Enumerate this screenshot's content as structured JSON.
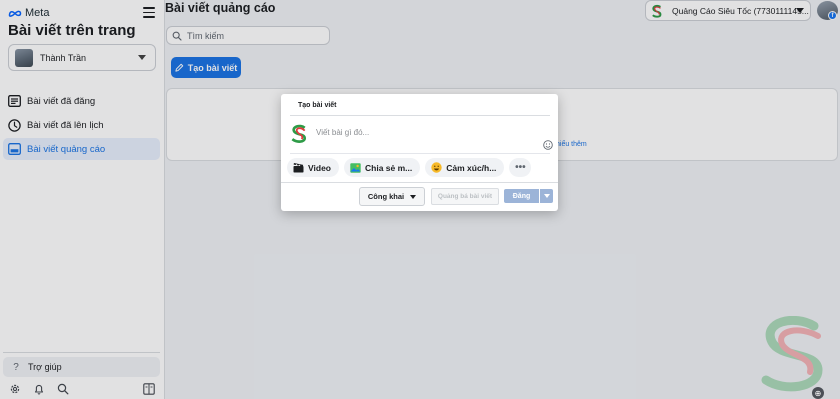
{
  "brand": {
    "name": "Meta",
    "icon": "meta-infinity-icon"
  },
  "sidebar": {
    "page_title": "Bài viết trên trang",
    "account": {
      "name": "Thành Trần"
    },
    "items": [
      {
        "label": "Bài viết đã đăng",
        "icon": "published-posts-icon",
        "active": false
      },
      {
        "label": "Bài viết đã lên lịch",
        "icon": "clock-icon",
        "active": false
      },
      {
        "label": "Bài viết quảng cáo",
        "icon": "ad-posts-icon",
        "active": true
      }
    ],
    "help": {
      "label": "Trợ giúp",
      "icon": "question-icon"
    },
    "footer_icons": [
      "settings-icon",
      "bell-icon",
      "search-icon",
      "panel-toggle-icon"
    ]
  },
  "header": {
    "title": "Bài viết quảng cáo",
    "business": {
      "name": "Quảng Cáo Siêu Tốc (7730111145..."
    }
  },
  "search": {
    "placeholder": "Tìm kiếm"
  },
  "toolbar": {
    "create_label": "Tạo bài viết"
  },
  "content": {
    "learn_more": "hiểu thêm"
  },
  "modal": {
    "title": "Tạo bài viết",
    "composer_placeholder": "Viết bài gì đó...",
    "attachments": [
      {
        "label": "Video",
        "icon": "video-camera-icon"
      },
      {
        "label": "Chia sẻ m...",
        "icon": "photo-icon"
      },
      {
        "label": "Cảm xúc/h...",
        "icon": "smiley-icon"
      }
    ],
    "more_label": "•••",
    "privacy_label": "Công khai",
    "boost_label": "Quảng bá bài viết",
    "post_label": "Đăng"
  },
  "colors": {
    "accent": "#1b74e4",
    "active_bg": "#e7f0fd",
    "background": "#f0f2f5",
    "disabled_post": "#9cb4d8"
  }
}
